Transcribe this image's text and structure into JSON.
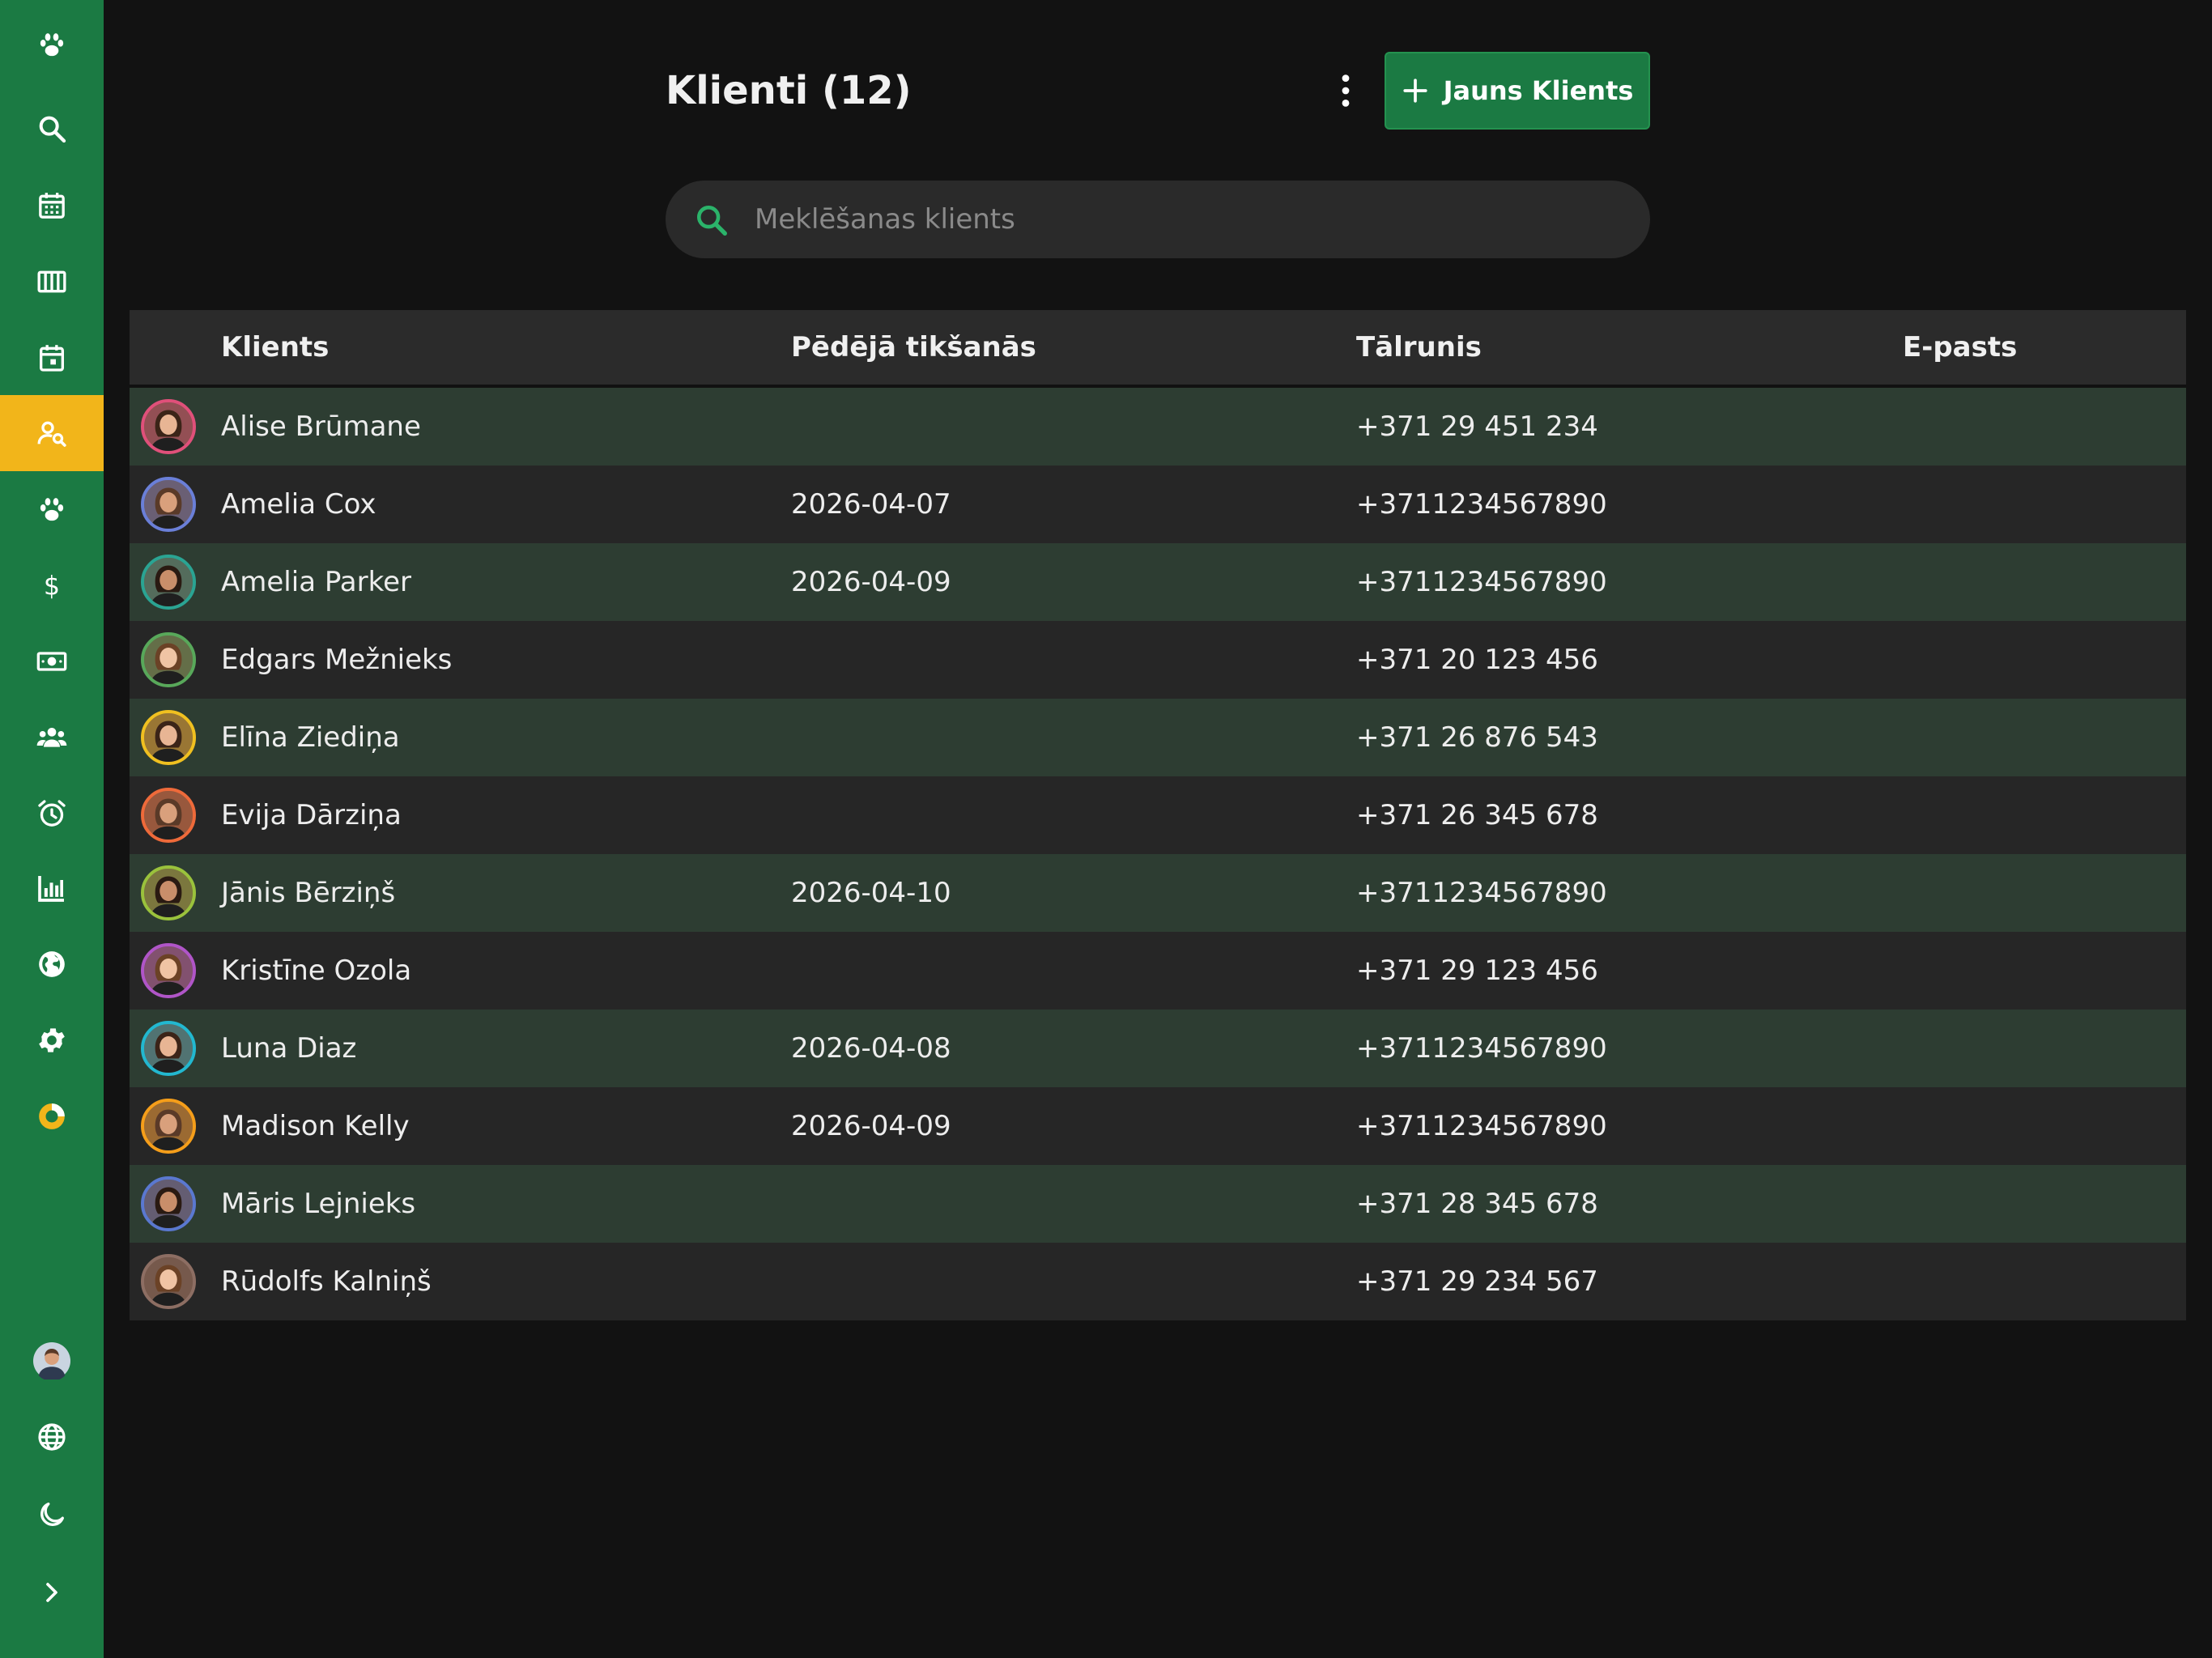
{
  "app": {
    "accent": "#1b7a43",
    "active_nav": "#f2b51a",
    "background": "#121212"
  },
  "sidebar": {
    "items": [
      {
        "icon": "paw-icon"
      },
      {
        "icon": "search-icon"
      },
      {
        "icon": "calendar-icon"
      },
      {
        "icon": "columns-icon"
      },
      {
        "icon": "calendar-day-icon"
      },
      {
        "icon": "client-search-icon",
        "active": true
      },
      {
        "icon": "paw-icon"
      },
      {
        "icon": "dollar-icon"
      },
      {
        "icon": "cash-icon"
      },
      {
        "icon": "group-icon"
      },
      {
        "icon": "alarm-icon"
      },
      {
        "icon": "bar-chart-icon"
      },
      {
        "icon": "globe-icon"
      },
      {
        "icon": "gear-icon"
      },
      {
        "icon": "donut-icon"
      }
    ],
    "bottom": [
      {
        "icon": "user-avatar"
      },
      {
        "icon": "language-globe-icon"
      },
      {
        "icon": "moon-icon"
      },
      {
        "icon": "chevron-right-icon"
      }
    ]
  },
  "header": {
    "title": "Klienti (12)",
    "new_button_label": "Jauns Klients",
    "more_icon": "kebab-menu-icon"
  },
  "search": {
    "placeholder": "Meklēšanas klients",
    "value": ""
  },
  "table": {
    "columns": [
      "Klients",
      "Pēdējā tikšanās",
      "Tālrunis",
      "E-pasts"
    ],
    "rows": [
      {
        "name": "Alise Brūmane",
        "last_meeting": "",
        "phone": "+371 29 451 234",
        "email": "",
        "ring": "#e0507a"
      },
      {
        "name": "Amelia Cox",
        "last_meeting": "2026-04-07",
        "phone": "+3711234567890",
        "email": "",
        "ring": "#6a7fd8"
      },
      {
        "name": "Amelia Parker",
        "last_meeting": "2026-04-09",
        "phone": "+3711234567890",
        "email": "",
        "ring": "#2aa493"
      },
      {
        "name": "Edgars Mežnieks",
        "last_meeting": "",
        "phone": "+371 20 123 456",
        "email": "",
        "ring": "#58a85a"
      },
      {
        "name": "Elīna Ziediņa",
        "last_meeting": "",
        "phone": "+371 26 876 543",
        "email": "",
        "ring": "#f0c020"
      },
      {
        "name": "Evija Dārziņa",
        "last_meeting": "",
        "phone": "+371 26 345 678",
        "email": "",
        "ring": "#ee6a3a"
      },
      {
        "name": "Jānis Bērziņš",
        "last_meeting": "2026-04-10",
        "phone": "+3711234567890",
        "email": "",
        "ring": "#9ac23c"
      },
      {
        "name": "Kristīne Ozola",
        "last_meeting": "",
        "phone": "+371 29 123 456",
        "email": "",
        "ring": "#b055c8"
      },
      {
        "name": "Luna Diaz",
        "last_meeting": "2026-04-08",
        "phone": "+3711234567890",
        "email": "",
        "ring": "#22b8d0"
      },
      {
        "name": "Madison Kelly",
        "last_meeting": "2026-04-09",
        "phone": "+3711234567890",
        "email": "",
        "ring": "#f59e1a"
      },
      {
        "name": "Māris Lejnieks",
        "last_meeting": "",
        "phone": "+371 28 345 678",
        "email": "",
        "ring": "#5a78d0"
      },
      {
        "name": "Rūdolfs Kalniņš",
        "last_meeting": "",
        "phone": "+371 29 234 567",
        "email": "",
        "ring": "#8d6e63"
      }
    ]
  }
}
